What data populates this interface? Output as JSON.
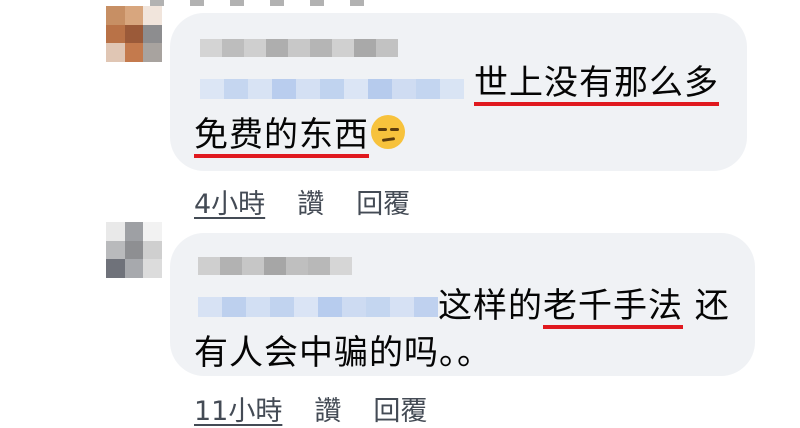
{
  "comments": [
    {
      "text_parts": [
        "世上没有那么多",
        "免费的东西"
      ],
      "emoji": "unamused-face",
      "time": "4小時",
      "like_label": "讚",
      "reply_label": "回覆"
    },
    {
      "text_parts": [
        "这样的",
        "老千手法",
        " 还",
        "有人会中骗的吗。。"
      ],
      "time": "11小時",
      "like_label": "讚",
      "reply_label": "回覆"
    }
  ],
  "colors": {
    "bubble_bg": "#f0f2f5",
    "underline_red": "#e0191f",
    "meta_text": "#444b55"
  }
}
